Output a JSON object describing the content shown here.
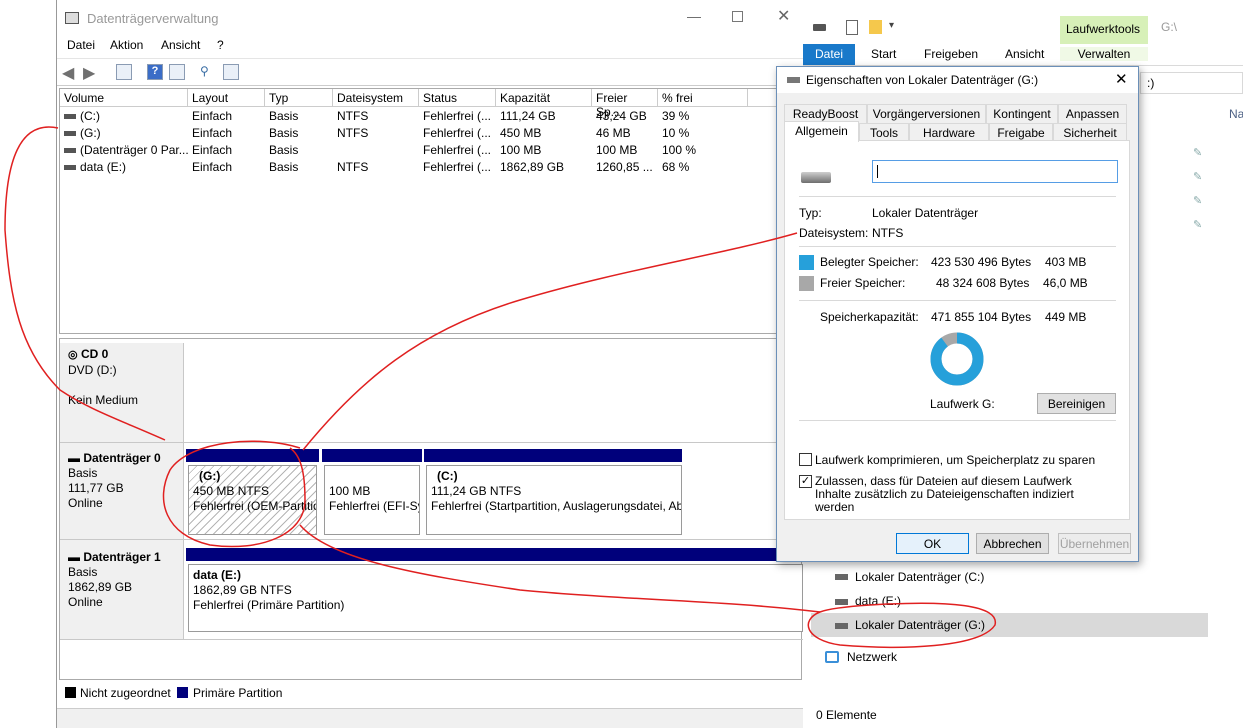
{
  "dm": {
    "title": "Datenträgerverwaltung",
    "menu": [
      "Datei",
      "Aktion",
      "Ansicht",
      "?"
    ],
    "columns": [
      "Volume",
      "Layout",
      "Typ",
      "Dateisystem",
      "Status",
      "Kapazität",
      "Freier Sp...",
      "% frei"
    ],
    "rows": [
      [
        "(C:)",
        "Einfach",
        "Basis",
        "NTFS",
        "Fehlerfrei (...",
        "111,24 GB",
        "43,24 GB",
        "39 %"
      ],
      [
        "(G:)",
        "Einfach",
        "Basis",
        "NTFS",
        "Fehlerfrei (...",
        "450 MB",
        "46 MB",
        "10 %"
      ],
      [
        "(Datenträger 0 Par...",
        "Einfach",
        "Basis",
        "",
        "Fehlerfrei (...",
        "100 MB",
        "100 MB",
        "100 %"
      ],
      [
        "data (E:)",
        "Einfach",
        "Basis",
        "NTFS",
        "Fehlerfrei (...",
        "1862,89 GB",
        "1260,85 ...",
        "68 %"
      ]
    ],
    "cd0": {
      "name": "CD 0",
      "type": "DVD (D:)",
      "state": "Kein Medium"
    },
    "disk0": {
      "name": "Datenträger 0",
      "type": "Basis",
      "size": "111,77 GB",
      "state": "Online"
    },
    "disk0_parts": [
      {
        "name": "(G:)",
        "size": "450 MB NTFS",
        "status": "Fehlerfrei (OEM-Partition)"
      },
      {
        "name": "",
        "size": "100 MB",
        "status": "Fehlerfrei (EFI-Systempartition)"
      },
      {
        "name": "(C:)",
        "size": "111,24 GB NTFS",
        "status": "Fehlerfrei (Startpartition, Auslagerungsdatei, Absturzabbild, Primäre Partition)"
      }
    ],
    "disk1": {
      "name": "Datenträger 1",
      "type": "Basis",
      "size": "1862,89 GB",
      "state": "Online"
    },
    "disk1_part": {
      "name": "data  (E:)",
      "size": "1862,89 GB NTFS",
      "status": "Fehlerfrei (Primäre Partition)"
    },
    "legend": [
      "Nicht zugeordnet",
      "Primäre Partition"
    ],
    "colors": {
      "unallocated": "#000000",
      "primary": "#00007b"
    }
  },
  "ex": {
    "context_tab": "Laufwerktools",
    "path": "G:\\",
    "tabs": [
      "Datei",
      "Start",
      "Freigeben",
      "Ansicht",
      "Verwalten"
    ],
    "nav": [
      "Lokaler Datenträger (C:)",
      "data (E:)",
      "Lokaler Datenträger (G:)",
      "Netzwerk"
    ],
    "status": "0 Elemente",
    "partial_address": ":)",
    "partial_header": "Na"
  },
  "dlg": {
    "title": "Eigenschaften von Lokaler Datenträger (G:)",
    "tabs_row1": [
      "ReadyBoost",
      "Vorgängerversionen",
      "Kontingent",
      "Anpassen"
    ],
    "tabs_row2": [
      "Allgemein",
      "Tools",
      "Hardware",
      "Freigabe",
      "Sicherheit"
    ],
    "name_value": "",
    "typ_label": "Typ:",
    "typ_value": "Lokaler Datenträger",
    "fs_label": "Dateisystem:",
    "fs_value": "NTFS",
    "used_label": "Belegter Speicher:",
    "used_bytes": "423 530 496 Bytes",
    "used_short": "403 MB",
    "free_label": "Freier Speicher:",
    "free_bytes": "48 324 608 Bytes",
    "free_short": "46,0 MB",
    "cap_label": "Speicherkapazität:",
    "cap_bytes": "471 855 104 Bytes",
    "cap_short": "449 MB",
    "drive_label": "Laufwerk G:",
    "cleanup": "Bereinigen",
    "compress": "Laufwerk komprimieren, um Speicherplatz zu sparen",
    "index": "Zulassen, dass für Dateien auf diesem Laufwerk Inhalte zusätzlich zu Dateieigenschaften indiziert werden",
    "ok": "OK",
    "cancel": "Abbrechen",
    "apply": "Übernehmen",
    "used_fraction": 0.8976,
    "used_color": "#26a0da",
    "free_color": "#a8a8a8"
  }
}
